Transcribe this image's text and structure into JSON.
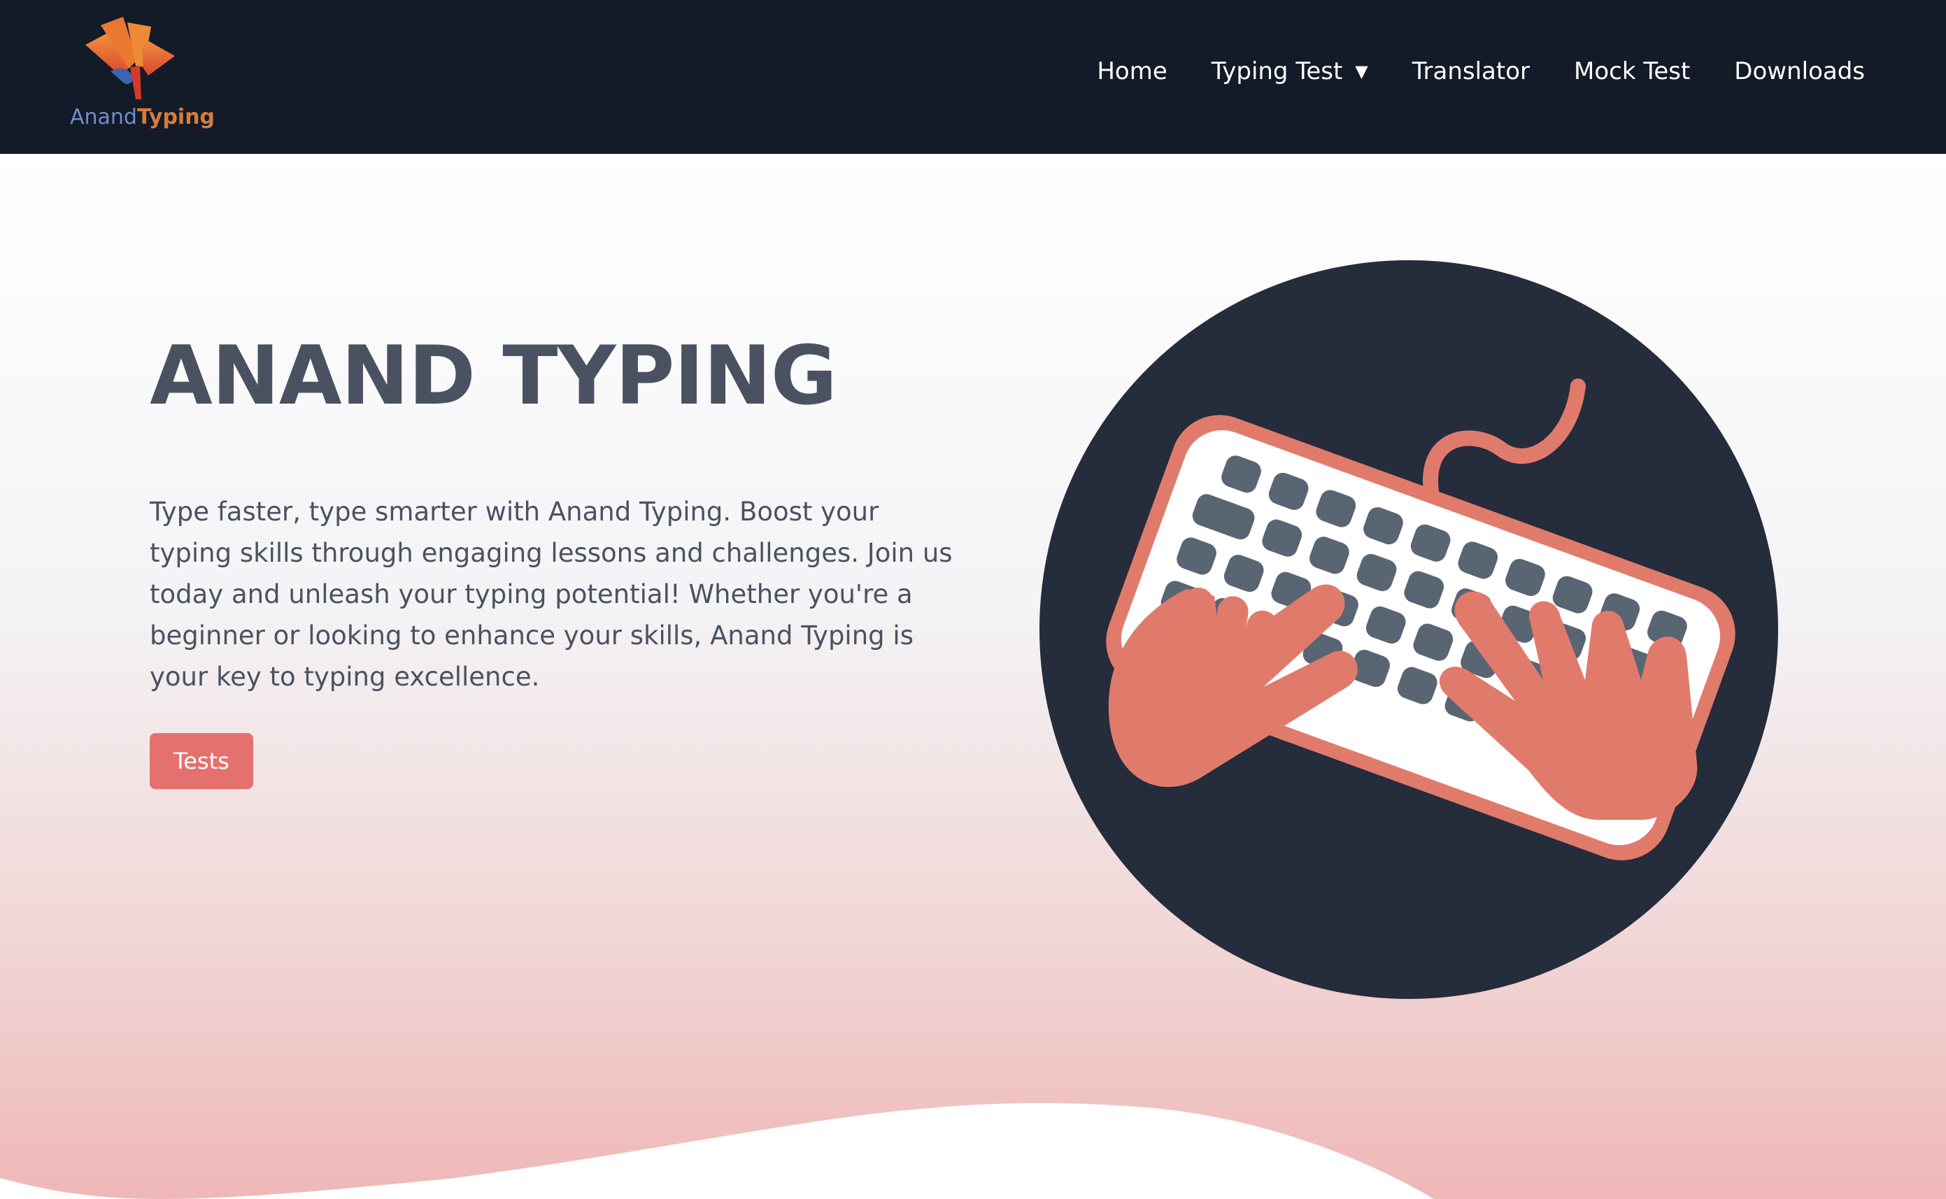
{
  "brand": {
    "name_part1": "Anand",
    "name_part2": "Typing",
    "colors": {
      "blue": "#6f8fc9",
      "orange": "#d87a3c"
    }
  },
  "nav": {
    "items": [
      {
        "label": "Home",
        "has_dropdown": false
      },
      {
        "label": "Typing Test",
        "has_dropdown": true,
        "caret": "▼"
      },
      {
        "label": "Translator",
        "has_dropdown": false
      },
      {
        "label": "Mock Test",
        "has_dropdown": false
      },
      {
        "label": "Downloads",
        "has_dropdown": false
      }
    ]
  },
  "hero": {
    "title": "ANAND TYPING",
    "description": "Type faster, type smarter with Anand Typing. Boost your typing skills through engaging lessons and challenges. Join us today and unleash your typing potential! Whether you're a beginner or looking to enhance your skills, Anand Typing is your key to typing excellence.",
    "cta_label": "Tests",
    "illustration_icon": "hands-typing-on-keyboard-icon"
  },
  "colors": {
    "navbar": "#131a28",
    "accent": "#e5716f",
    "text": "#4a5261",
    "circle": "#252c3b",
    "hand": "#e07b6c",
    "key": "#5a6573",
    "keyboard_body": "#ffffff"
  }
}
